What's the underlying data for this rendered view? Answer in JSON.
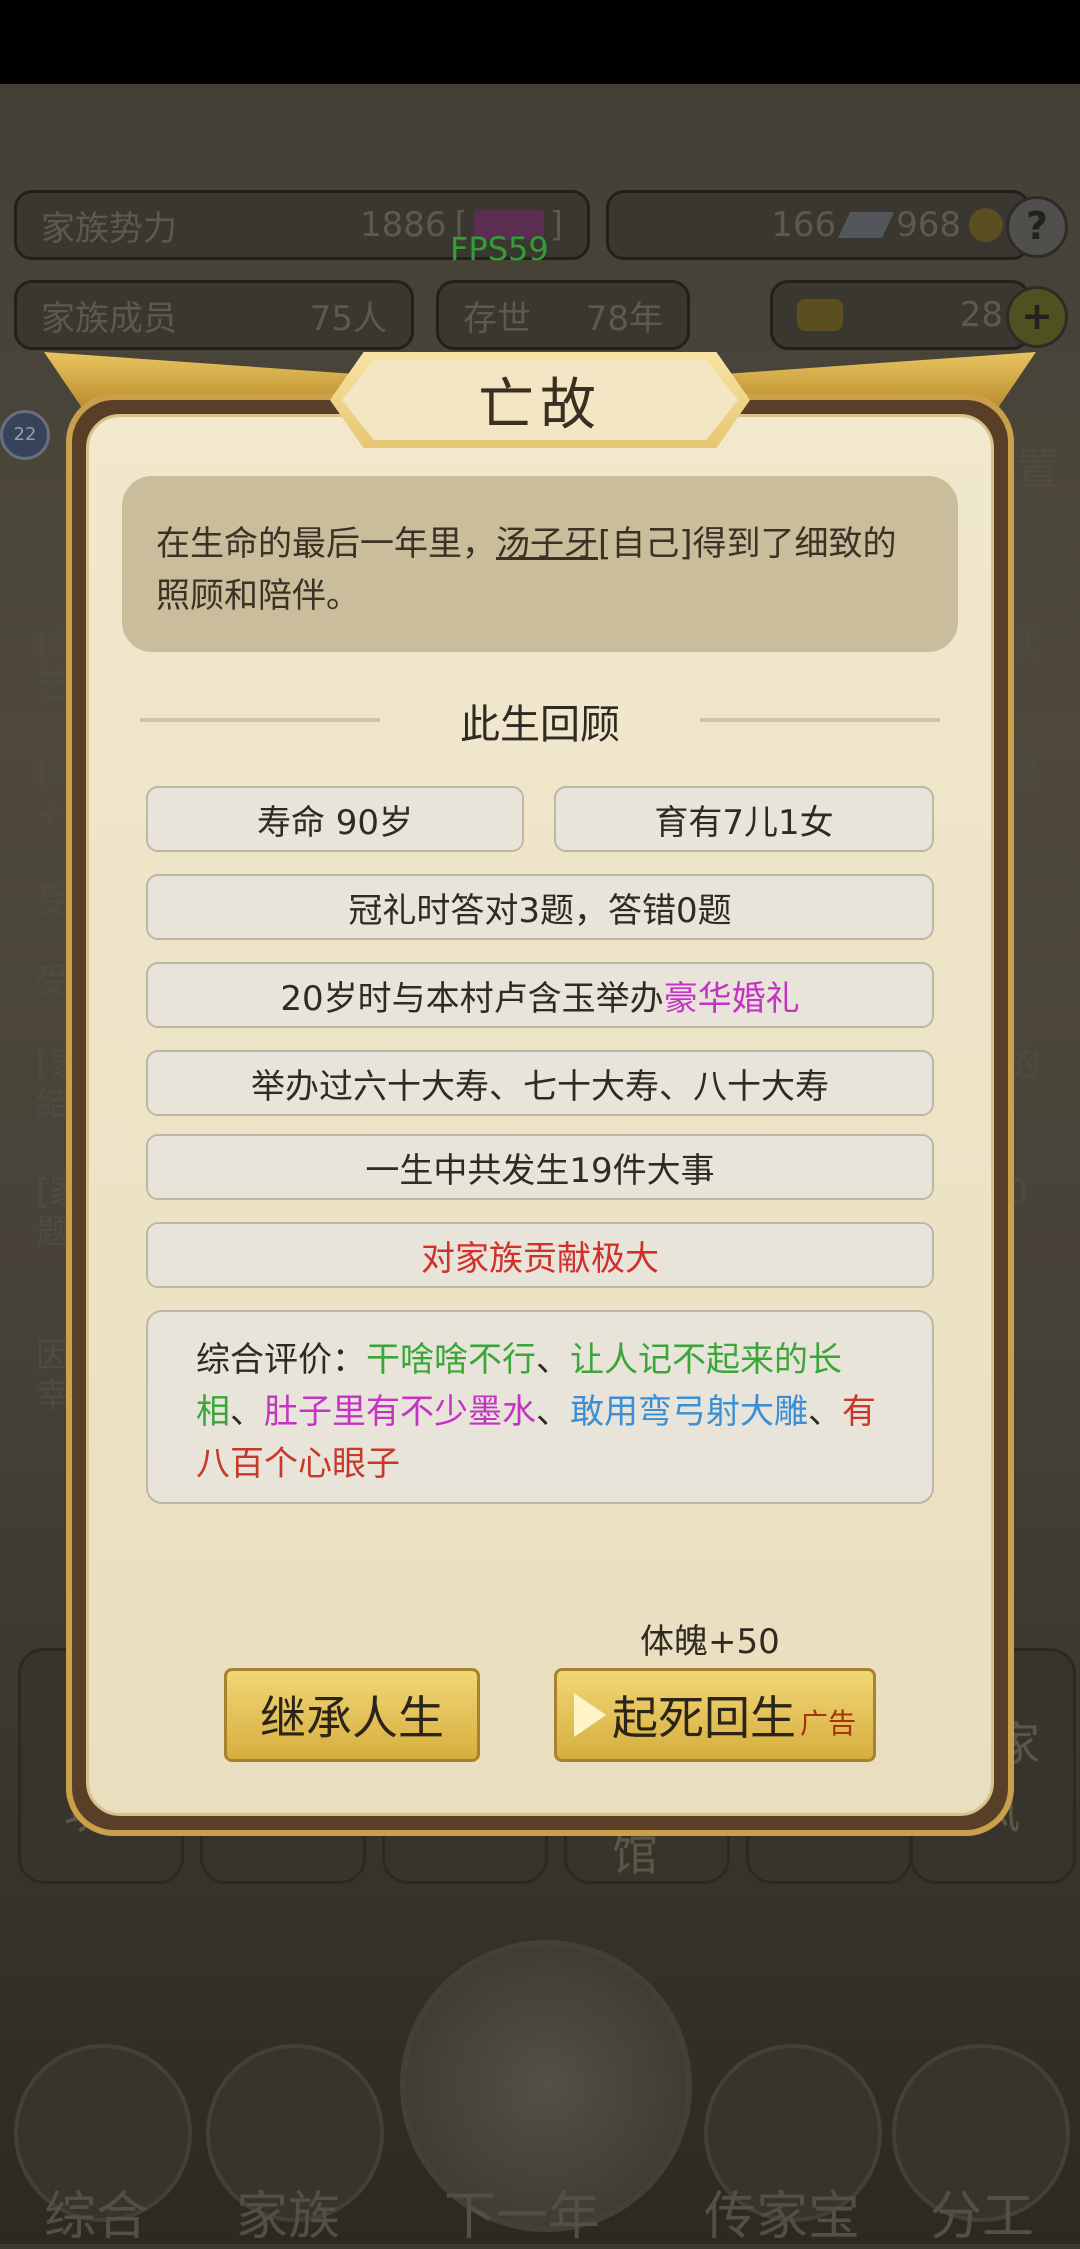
{
  "hud": {
    "clan_power_label": "家族势力",
    "clan_power_value": "1886",
    "clan_power_extra": "[",
    "clan_power_close": "]",
    "resource_a": "166",
    "resource_b": "968",
    "members_label": "家族成员",
    "members_value": "75人",
    "alive_label": "存世",
    "alive_value": "78年",
    "gold": "28",
    "help": "?",
    "add": "+",
    "fps": "FPS59",
    "badge": "22",
    "settings_partial": "置"
  },
  "background": {
    "row_snippets": [
      "[侍",
      "艺",
      "[侍",
      "+6",
      "受",
      "受",
      "[家",
      "结",
      "[家",
      "题",
      "因",
      "幸"
    ],
    "right_snippets": [
      "武",
      "瑰",
      "的",
      "0",
      "家"
    ],
    "tiles": [
      "功",
      "馆",
      "家",
      "风"
    ]
  },
  "nav": {
    "items": [
      "综合",
      "家族",
      "下一年",
      "传家宝",
      "分工"
    ]
  },
  "dialog": {
    "title": "亡故",
    "desc_pre": "在生命的最后一年里，",
    "desc_name": "汤子牙",
    "desc_post": "[自己]得到了细致的照顾和陪伴。",
    "section_title": "此生回顾",
    "lifespan": "寿命 90岁",
    "children": "育有7儿1女",
    "coming_of_age": "冠礼时答对3题，答错0题",
    "wedding_pre": "20岁时与本村卢含玉举办",
    "wedding_highlight": "豪华婚礼",
    "birthdays": "举办过六十大寿、七十大寿、八十大寿",
    "events": "一生中共发生19件大事",
    "contribution": "对家族贡献极大",
    "eval_label": "综合评价：",
    "eval_traits": [
      {
        "text": "干啥啥不行",
        "color": "#3aa63a"
      },
      {
        "text": "、",
        "color": "#2f2a22"
      },
      {
        "text": "让人记不起来的长相",
        "color": "#3aa63a"
      },
      {
        "text": "、",
        "color": "#2f2a22"
      },
      {
        "text": "肚子里有不少墨水",
        "color": "#c533c5"
      },
      {
        "text": "、",
        "color": "#2f2a22"
      },
      {
        "text": "敢用弯弓射大雕",
        "color": "#3a8fd6"
      },
      {
        "text": "、",
        "color": "#2f2a22"
      },
      {
        "text": "有八百个心眼子",
        "color": "#c8382a"
      }
    ],
    "bonus": "体魄+50",
    "inherit_button": "继承人生",
    "revive_button": "起死回生",
    "ad_tag": "广告"
  },
  "colors": {
    "wedding_highlight": "#c533c5",
    "contribution": "#d0312a",
    "fps": "#45d14c"
  }
}
